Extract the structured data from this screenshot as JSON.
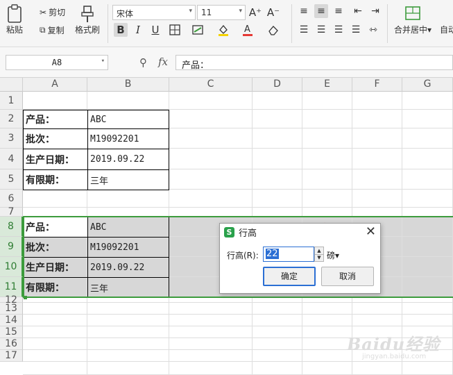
{
  "ribbon": {
    "paste_label": "粘贴",
    "cut_label": "剪切",
    "copy_label": "复制",
    "format_painter_label": "格式刷",
    "font_name": "宋体",
    "font_size": "11",
    "increase_font": "A⁺",
    "decrease_font": "A⁻",
    "bold": "B",
    "italic": "I",
    "underline": "U",
    "merge_center_label": "合并居中",
    "auto_wrap_label": "自动"
  },
  "formula_bar": {
    "cell_reference": "A8",
    "fx": "fx",
    "content": "产品："
  },
  "columns": [
    "A",
    "B",
    "C",
    "D",
    "E",
    "F",
    "G"
  ],
  "rows": [
    "1",
    "2",
    "3",
    "4",
    "5",
    "6",
    "7",
    "8",
    "9",
    "10",
    "11",
    "12",
    "13",
    "14",
    "15",
    "16",
    "17"
  ],
  "table1": [
    {
      "label": "产品：",
      "value": "ABC"
    },
    {
      "label": "批次：",
      "value": "M19092201"
    },
    {
      "label": "生产日期：",
      "value": "2019.09.22"
    },
    {
      "label": "有限期：",
      "value": "三年"
    }
  ],
  "table2": [
    {
      "label": "产品：",
      "value": "ABC"
    },
    {
      "label": "批次：",
      "value": "M19092201"
    },
    {
      "label": "生产日期：",
      "value": "2019.09.22"
    },
    {
      "label": "有限期：",
      "value": "三年"
    }
  ],
  "dialog": {
    "title": "行高",
    "field_label": "行高(R):",
    "value": "22",
    "unit": "磅",
    "ok_label": "确定",
    "cancel_label": "取消"
  },
  "colors": {
    "accent": "#3c9b3c",
    "selection": "#d7d7d7",
    "arrow": "#e53935",
    "focus": "#2b6fd4"
  },
  "watermark": {
    "text": "Baidu经验",
    "sub": "jingyan.baidu.com"
  }
}
